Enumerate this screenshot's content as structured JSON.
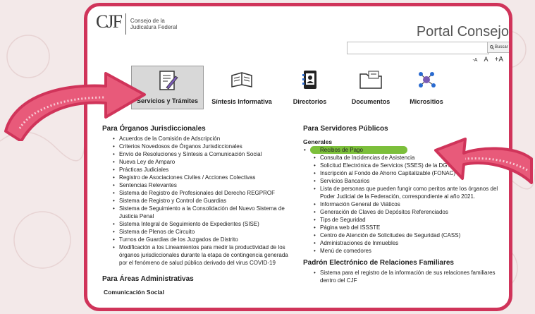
{
  "header": {
    "logo_mark": "CJF",
    "logo_line1": "Consejo de la",
    "logo_line2": "Judicatura Federal",
    "portal_title": "Portal Consejo"
  },
  "search": {
    "placeholder": "",
    "button_label": "Buscar"
  },
  "font_size_controls": [
    "-A",
    "A",
    "+A"
  ],
  "nav": [
    {
      "label": "Servicios y Trámites",
      "icon": "document-pen-icon",
      "active": true
    },
    {
      "label": "Síntesis Informativa",
      "icon": "open-book-icon",
      "active": false
    },
    {
      "label": "Directorios",
      "icon": "address-book-icon",
      "active": false
    },
    {
      "label": "Documentos",
      "icon": "folder-icon",
      "active": false
    },
    {
      "label": "Micrositios",
      "icon": "network-icon",
      "active": false
    }
  ],
  "left": {
    "heading": "Para Órganos Jurisdiccionales",
    "items": [
      "Acuerdos de la Comisión de Adscripción",
      "Criterios Novedosos de Órganos Jurisdiccionales",
      "Envío de Resoluciones y Síntesis a Comunicación Social",
      "Nueva Ley de Amparo",
      "Prácticas Judiciales",
      "Registro de Asociaciones Civiles / Acciones Colectivas",
      "Sentencias Relevantes",
      "Sistema de Registro de Profesionales del Derecho REGPROF",
      "Sistema de Registro y Control de Guardias",
      "Sistema de Seguimiento a la Consolidación del Nuevo Sistema de Justicia Penal",
      "Sistema Integral de Seguimiento de Expedientes (SISE)",
      "Sistema de Plenos de Circuito",
      "Turnos de Guardias de los Juzgados de Distrito",
      "Modificación a los Lineamientos para medir la productividad de los órganos jurisdiccionales durante la etapa de contingencia generada por el fenómeno de salud pública derivado del virus COVID-19"
    ],
    "heading2": "Para Áreas Administrativas",
    "sub2": "Comunicación Social"
  },
  "right": {
    "heading": "Para Servidores Públicos",
    "subheading": "Generales",
    "items": [
      "Recibos de Pago",
      "Consulta de Incidencias de Asistencia",
      "Solicitud Electrónica de Servicios (SSES) de la DGTI",
      "Inscripción al Fondo de Ahorro Capitalizable (FONAC)",
      "Servicios Bancarios",
      "Lista de personas que pueden fungir como peritos ante los órganos del Poder Judicial de la Federación, correspondiente al año 2021.",
      "Información General de Viáticos",
      "Generación de Claves de Depósitos Referenciados",
      "Tips de Seguridad",
      "Página web del ISSSTE",
      "Centro de Atención de Solicitudes de Seguridad (CASS)",
      "Administraciones de Inmuebles",
      "Menú de comedores"
    ],
    "highlighted_index": 0,
    "heading2": "Padrón Electrónico de Relaciones Familiares",
    "items2": [
      "Sistema para el registro de la información de sus relaciones familiares dentro del CJF"
    ]
  },
  "colors": {
    "frame": "#d0345a",
    "highlight": "#7cbf3b",
    "arrow": "#d0345a"
  }
}
